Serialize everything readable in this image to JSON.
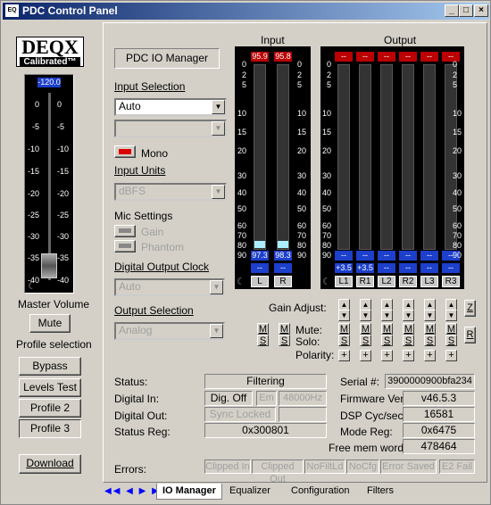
{
  "window": {
    "title": "PDC Control Panel",
    "app_icon": "EQ"
  },
  "logo": {
    "line1": "DEQX",
    "line2": "Calibrated™"
  },
  "master": {
    "value": "-120.0",
    "ticks": [
      "0",
      "-5",
      "-10",
      "-15",
      "-20",
      "-25",
      "-30",
      "-35",
      "-40",
      "∞"
    ],
    "label": "Master Volume",
    "mute": "Mute",
    "profile_label": "Profile selection",
    "profiles": [
      "Bypass",
      "Levels Test",
      "Profile 2",
      "Profile 3"
    ],
    "download": "Download"
  },
  "io": {
    "title": "PDC IO Manager",
    "input_selection": "Input Selection",
    "input_value": "Auto",
    "mono": "Mono",
    "input_units": "Input Units",
    "units_value": "dBFS",
    "mic_settings": "Mic Settings",
    "gain": "Gain",
    "phantom": "Phantom",
    "digital_clock": "Digital Output Clock",
    "clock_value": "Auto",
    "output_selection": "Output Selection",
    "output_value": "Analog"
  },
  "input_meter": {
    "title": "Input",
    "peaks": [
      "95.9",
      "95.8"
    ],
    "levels": [
      "97.3",
      "98.3"
    ],
    "extra": [
      "--",
      "--"
    ],
    "channels": [
      "L",
      "R"
    ],
    "ticks": [
      "0",
      "2",
      "5",
      "10",
      "15",
      "20",
      "30",
      "40",
      "50",
      "60",
      "70",
      "80",
      "90"
    ]
  },
  "output_meter": {
    "title": "Output",
    "peaks": [
      "--",
      "--",
      "--",
      "--",
      "--",
      "--"
    ],
    "levels": [
      "+3.5",
      "+3.5",
      "--",
      "--",
      "--",
      "--"
    ],
    "extra": [
      "--",
      "--",
      "--",
      "--",
      "--",
      "--"
    ],
    "channels": [
      "L1",
      "R1",
      "L2",
      "R2",
      "L3",
      "R3"
    ]
  },
  "controls": {
    "gain_adjust": "Gain Adjust:",
    "mute": "Mute:",
    "solo": "Solo:",
    "polarity": "Polarity:",
    "z": "Z",
    "r": "R",
    "m": "M",
    "s": "S"
  },
  "status": {
    "status_label": "Status:",
    "status_value": "Filtering",
    "digital_in": "Digital In:",
    "dig_off": "Dig. Off",
    "em": "Em",
    "rate": "48000Hz",
    "digital_out": "Digital Out:",
    "sync": "Sync Locked",
    "status_reg": "Status Reg:",
    "reg_value": "0x300801",
    "serial_label": "Serial #:",
    "serial": "3900000900bfa234",
    "fw_label": "Firmware Ver:",
    "fw": "v46.5.3",
    "dsp_label": "DSP Cyc/sec:",
    "dsp": "16581",
    "mode_label": "Mode Reg:",
    "mode": "0x6475",
    "mem_label": "Free mem words:",
    "mem": "478464",
    "errors": "Errors:",
    "err_items": [
      "Clipped In",
      "Clipped Out",
      "NoFiltLd",
      "NoCfg",
      "Error Saved",
      "E2 Fail"
    ]
  },
  "tabs": [
    "IO Manager",
    "Equalizer",
    "Configuration",
    "Filters"
  ]
}
